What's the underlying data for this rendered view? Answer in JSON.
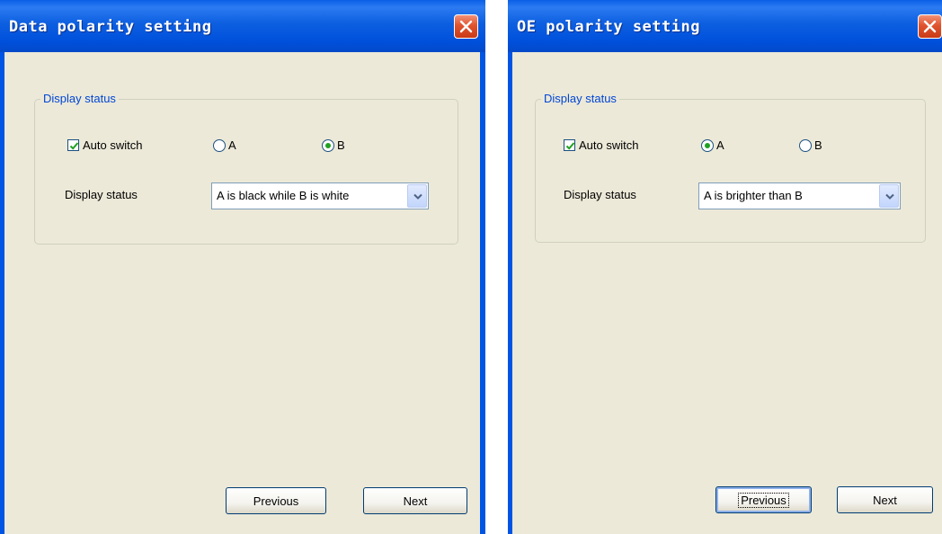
{
  "dialogs": [
    {
      "title": "Data polarity setting",
      "group_title": "Display status",
      "auto_switch": {
        "label": "Auto switch",
        "checked": true
      },
      "radio_a": {
        "label": "A",
        "selected": false
      },
      "radio_b": {
        "label": "B",
        "selected": true
      },
      "display_status_label": "Display status",
      "display_status_value": "A is black while B is white",
      "previous_label": "Previous",
      "next_label": "Next"
    },
    {
      "title": "OE polarity setting",
      "group_title": "Display status",
      "auto_switch": {
        "label": "Auto switch",
        "checked": true
      },
      "radio_a": {
        "label": "A",
        "selected": true
      },
      "radio_b": {
        "label": "B",
        "selected": false
      },
      "display_status_label": "Display status",
      "display_status_value": "A is brighter than B",
      "previous_label": "Previous",
      "next_label": "Next"
    }
  ],
  "colors": {
    "title_bar": "#0054e3",
    "client_bg": "#ece9d8",
    "group_title": "#0046d5",
    "close_button": "#e0532f",
    "radio_dot": "#21a121"
  },
  "icons": {
    "close": "close-icon",
    "check": "checkmark-icon",
    "dropdown": "chevron-down-icon"
  }
}
